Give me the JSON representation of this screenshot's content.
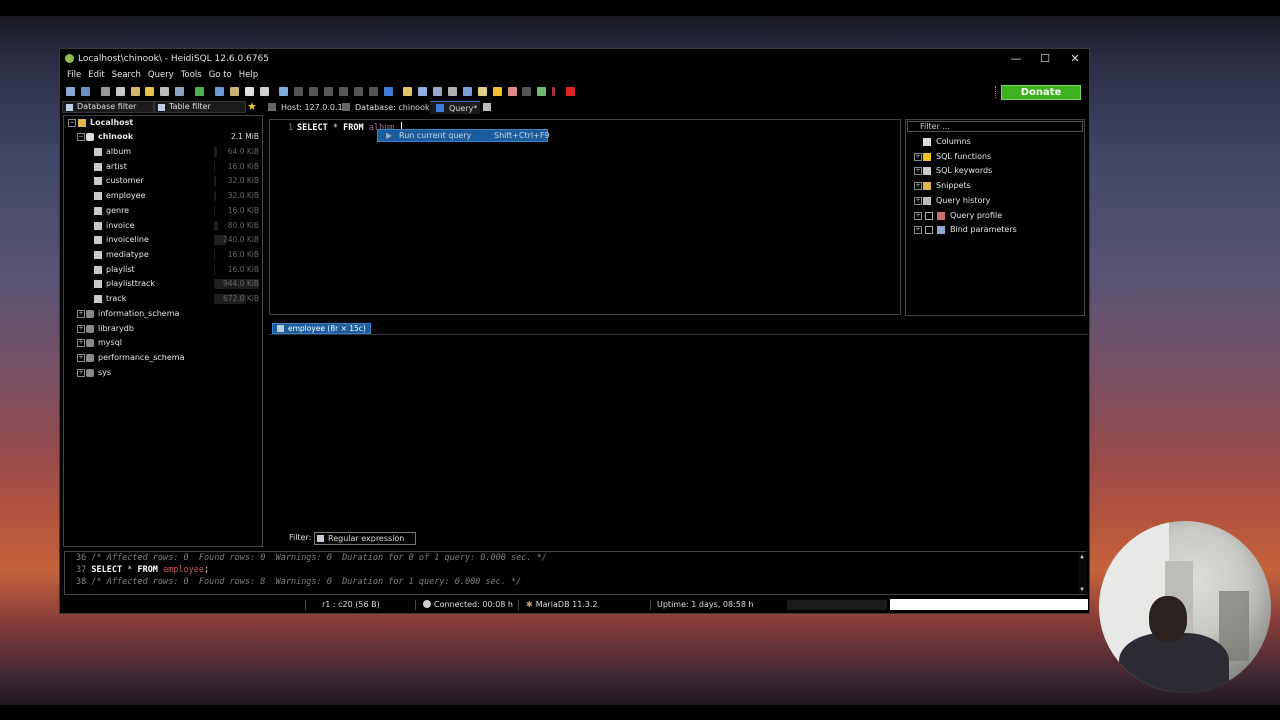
{
  "window": {
    "title": "Localhost\\chinook\\ - HeidiSQL 12.6.0.6765",
    "controls": {
      "minimize": "—",
      "maximize": "☐",
      "close": "✕"
    }
  },
  "menu": [
    "File",
    "Edit",
    "Search",
    "Query",
    "Tools",
    "Go to",
    "Help"
  ],
  "toolbar": {
    "donate_label": "Donate"
  },
  "filters": {
    "database_filter": "Database filter",
    "table_filter": "Table filter"
  },
  "query_tabs": {
    "host": "Host: 127.0.0.1",
    "database": "Database: chinook",
    "query": "Query*"
  },
  "tree": {
    "root": "Localhost",
    "active_db": {
      "name": "chinook",
      "size": "2.1 MiB"
    },
    "tables": [
      {
        "name": "album",
        "size": "64.0 KiB",
        "fill": 0.07
      },
      {
        "name": "artist",
        "size": "16.0 KiB",
        "fill": 0.02
      },
      {
        "name": "customer",
        "size": "32.0 KiB",
        "fill": 0.04
      },
      {
        "name": "employee",
        "size": "32.0 KiB",
        "fill": 0.04
      },
      {
        "name": "genre",
        "size": "16.0 KiB",
        "fill": 0.02
      },
      {
        "name": "invoice",
        "size": "80.0 KiB",
        "fill": 0.09
      },
      {
        "name": "invoiceline",
        "size": "240.0 KiB",
        "fill": 0.27
      },
      {
        "name": "mediatype",
        "size": "16.0 KiB",
        "fill": 0.02
      },
      {
        "name": "playlist",
        "size": "16.0 KiB",
        "fill": 0.02
      },
      {
        "name": "playlisttrack",
        "size": "944.0 KiB",
        "fill": 1.0
      },
      {
        "name": "track",
        "size": "672.0 KiB",
        "fill": 0.71
      }
    ],
    "other_dbs": [
      "information_schema",
      "librarydb",
      "mysql",
      "performance_schema",
      "sys"
    ]
  },
  "editor": {
    "line": "1",
    "kw1": "SELECT",
    "star": "*",
    "kw2": "FROM",
    "ident": "album",
    "autocomplete": {
      "label": "Run current query",
      "shortcut": "Shift+Ctrl+F9"
    }
  },
  "helper": {
    "filter_placeholder": "Filter ...",
    "items": [
      "Columns",
      "SQL functions",
      "SQL keywords",
      "Snippets",
      "Query history",
      "Query profile",
      "Bind parameters"
    ]
  },
  "result_tab": "employee (8r × 15c)",
  "result_filter": {
    "label": "Filter:",
    "mode": "Regular expression"
  },
  "log": [
    {
      "n": "36",
      "text": "/* Affected rows: 0  Found rows: 0  Warnings: 0  Duration for 0 of 1 query: 0.000 sec. */"
    },
    {
      "n": "37",
      "kw1": "SELECT",
      "mid": " * ",
      "kw2": "FROM",
      "id": "employee",
      "end": ";"
    },
    {
      "n": "38",
      "text": "/* Affected rows: 0  Found rows: 8  Warnings: 0  Duration for 1 query: 0.000 sec. */"
    }
  ],
  "status": {
    "cursor": "r1 : c20 (56 B)",
    "connected": "Connected: 00:08 h",
    "server": "MariaDB 11.3.2",
    "uptime": "Uptime: 1 days, 08:58 h"
  },
  "colors": {
    "donate": "#3cb01e",
    "accent": "#1b5d9c",
    "ident": "#a36d8e"
  }
}
